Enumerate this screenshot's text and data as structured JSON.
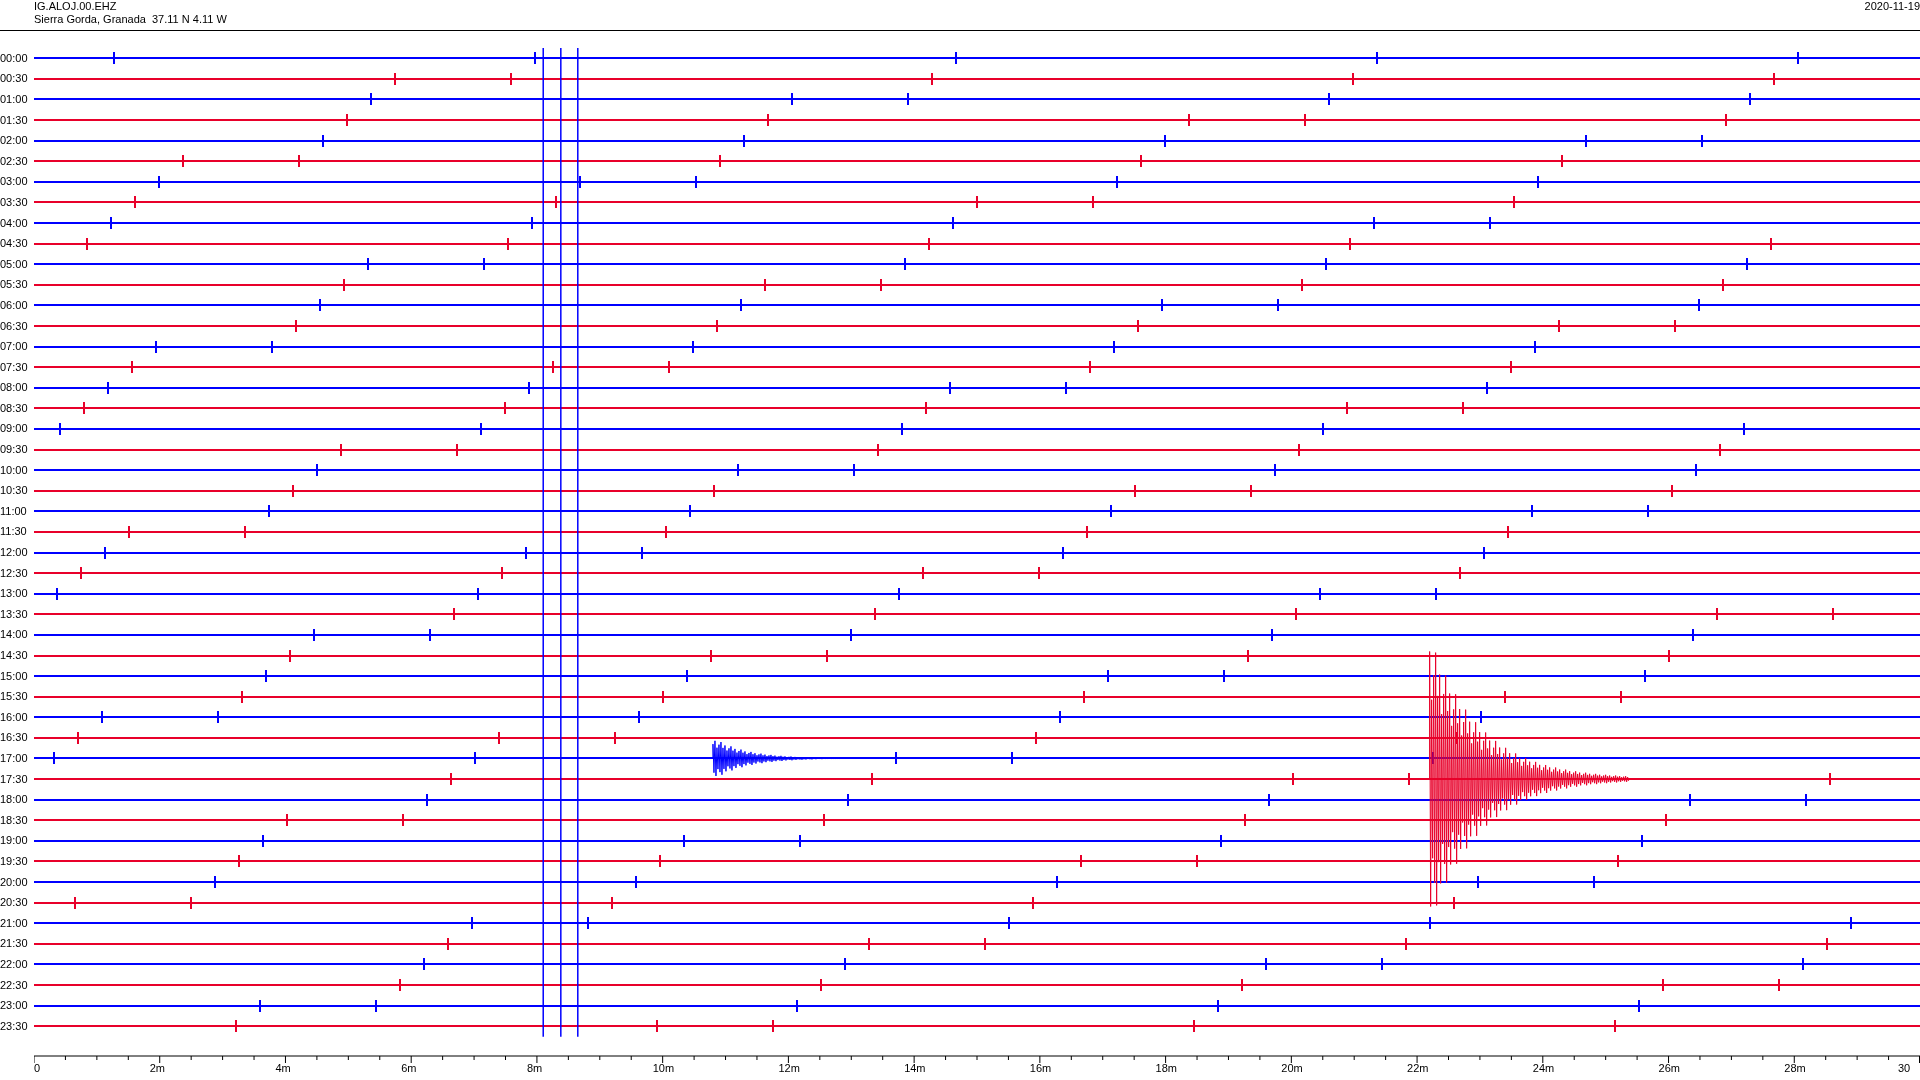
{
  "header": {
    "station": "IG.ALOJ.00.EHZ",
    "location": "Sierra Gorda, Granada  37.11 N 4.11 W",
    "date": "2020-11-19"
  },
  "rows": [
    {
      "time": "00:00",
      "color": "#0000ff"
    },
    {
      "time": "00:30",
      "color": "#e8002a"
    },
    {
      "time": "01:00",
      "color": "#0000ff"
    },
    {
      "time": "01:30",
      "color": "#e8002a"
    },
    {
      "time": "02:00",
      "color": "#0000ff"
    },
    {
      "time": "02:30",
      "color": "#e8002a"
    },
    {
      "time": "03:00",
      "color": "#0000ff"
    },
    {
      "time": "03:30",
      "color": "#e8002a"
    },
    {
      "time": "04:00",
      "color": "#0000ff"
    },
    {
      "time": "04:30",
      "color": "#e8002a"
    },
    {
      "time": "05:00",
      "color": "#0000ff"
    },
    {
      "time": "05:30",
      "color": "#e8002a"
    },
    {
      "time": "06:00",
      "color": "#0000ff"
    },
    {
      "time": "06:30",
      "color": "#e8002a"
    },
    {
      "time": "07:00",
      "color": "#0000ff"
    },
    {
      "time": "07:30",
      "color": "#e8002a"
    },
    {
      "time": "08:00",
      "color": "#0000ff"
    },
    {
      "time": "08:30",
      "color": "#e8002a"
    },
    {
      "time": "09:00",
      "color": "#0000ff"
    },
    {
      "time": "09:30",
      "color": "#e8002a"
    },
    {
      "time": "10:00",
      "color": "#0000ff"
    },
    {
      "time": "10:30",
      "color": "#e8002a"
    },
    {
      "time": "11:00",
      "color": "#0000ff"
    },
    {
      "time": "11:30",
      "color": "#e8002a"
    },
    {
      "time": "12:00",
      "color": "#0000ff"
    },
    {
      "time": "12:30",
      "color": "#e8002a"
    },
    {
      "time": "13:00",
      "color": "#0000ff"
    },
    {
      "time": "13:30",
      "color": "#e8002a"
    },
    {
      "time": "14:00",
      "color": "#0000ff"
    },
    {
      "time": "14:30",
      "color": "#e8002a"
    },
    {
      "time": "15:00",
      "color": "#0000ff"
    },
    {
      "time": "15:30",
      "color": "#e8002a"
    },
    {
      "time": "16:00",
      "color": "#0000ff"
    },
    {
      "time": "16:30",
      "color": "#e8002a"
    },
    {
      "time": "17:00",
      "color": "#0000ff"
    },
    {
      "time": "17:30",
      "color": "#e8002a"
    },
    {
      "time": "18:00",
      "color": "#0000ff"
    },
    {
      "time": "18:30",
      "color": "#e8002a"
    },
    {
      "time": "19:00",
      "color": "#0000ff"
    },
    {
      "time": "19:30",
      "color": "#e8002a"
    },
    {
      "time": "20:00",
      "color": "#0000ff"
    },
    {
      "time": "20:30",
      "color": "#e8002a"
    },
    {
      "time": "21:00",
      "color": "#0000ff"
    },
    {
      "time": "21:30",
      "color": "#e8002a"
    },
    {
      "time": "22:00",
      "color": "#0000ff"
    },
    {
      "time": "22:30",
      "color": "#e8002a"
    },
    {
      "time": "23:00",
      "color": "#0000ff"
    },
    {
      "time": "23:30",
      "color": "#e8002a"
    }
  ],
  "x_axis": {
    "labels": [
      "0",
      "2m",
      "4m",
      "6m",
      "8m",
      "10m",
      "12m",
      "14m",
      "16m",
      "18m",
      "20m",
      "22m",
      "24m",
      "26m",
      "28m",
      "30"
    ]
  }
}
